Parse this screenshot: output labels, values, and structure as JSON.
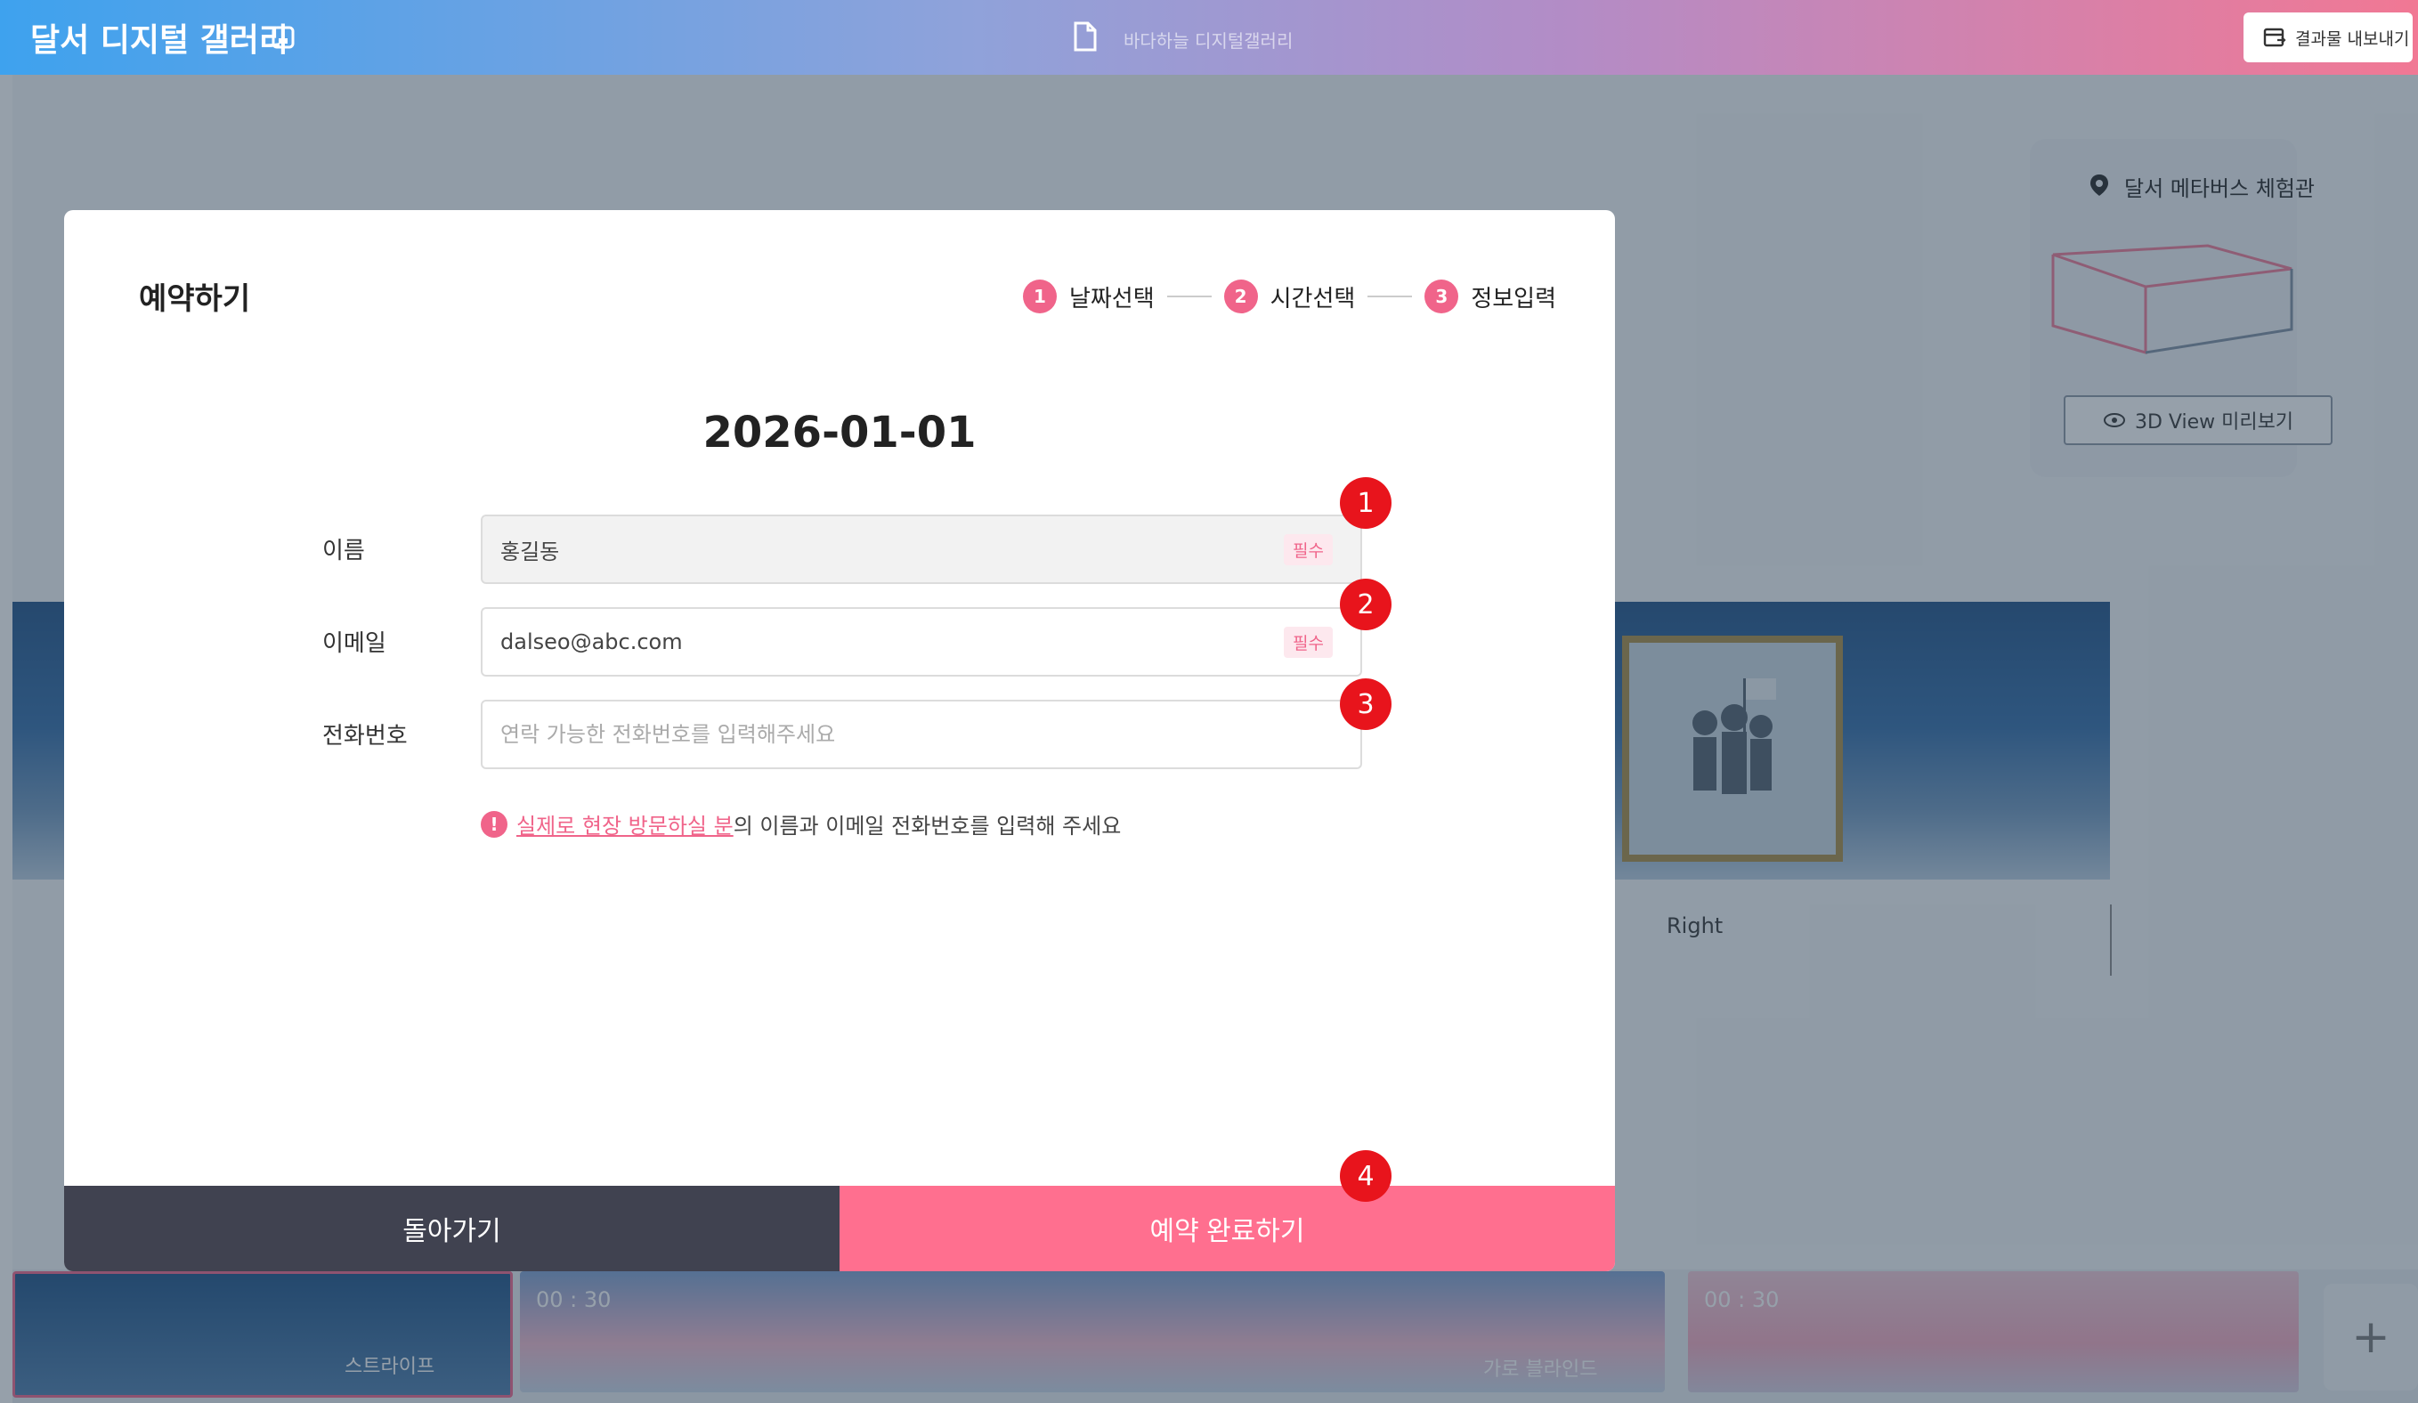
{
  "app": {
    "title": "달서 디지털 갤러리",
    "document_title": "바다하늘 디지털갤러리",
    "export_label": "결과물 내보내기"
  },
  "background": {
    "right_wall_label": "Right",
    "meta_panel": {
      "title": "달서 메타버스 체험관",
      "view3d_label": "3D View 미리보기"
    },
    "timeline": {
      "clips": [
        {
          "label": "스트라이프",
          "time": ""
        },
        {
          "label": "가로 블라인드",
          "time": "00 : 30"
        },
        {
          "label": "",
          "time": "00 : 30"
        }
      ],
      "add_label": "+"
    }
  },
  "modal": {
    "title": "예약하기",
    "steps": [
      {
        "num": "1",
        "label": "날짜선택"
      },
      {
        "num": "2",
        "label": "시간선택"
      },
      {
        "num": "3",
        "label": "정보입력"
      }
    ],
    "date": "2026-01-01",
    "fields": {
      "name": {
        "label": "이름",
        "value": "홍길동",
        "required": "필수"
      },
      "email": {
        "label": "이메일",
        "value": "dalseo@abc.com",
        "required": "필수"
      },
      "phone": {
        "label": "전화번호",
        "placeholder": "연락 가능한 전화번호를 입력해주세요"
      }
    },
    "notice": {
      "icon": "!",
      "emphasis": "실제로 현장 방문하실 분",
      "rest": "의 이름과 이메일 전화번호를 입력해 주세요"
    },
    "back_label": "돌아가기",
    "confirm_label": "예약 완료하기"
  },
  "annotations": [
    "1",
    "2",
    "3",
    "4"
  ],
  "colors": {
    "accent": "#ff6f8f",
    "marker": "#e8141c",
    "dark_button": "#404250"
  }
}
